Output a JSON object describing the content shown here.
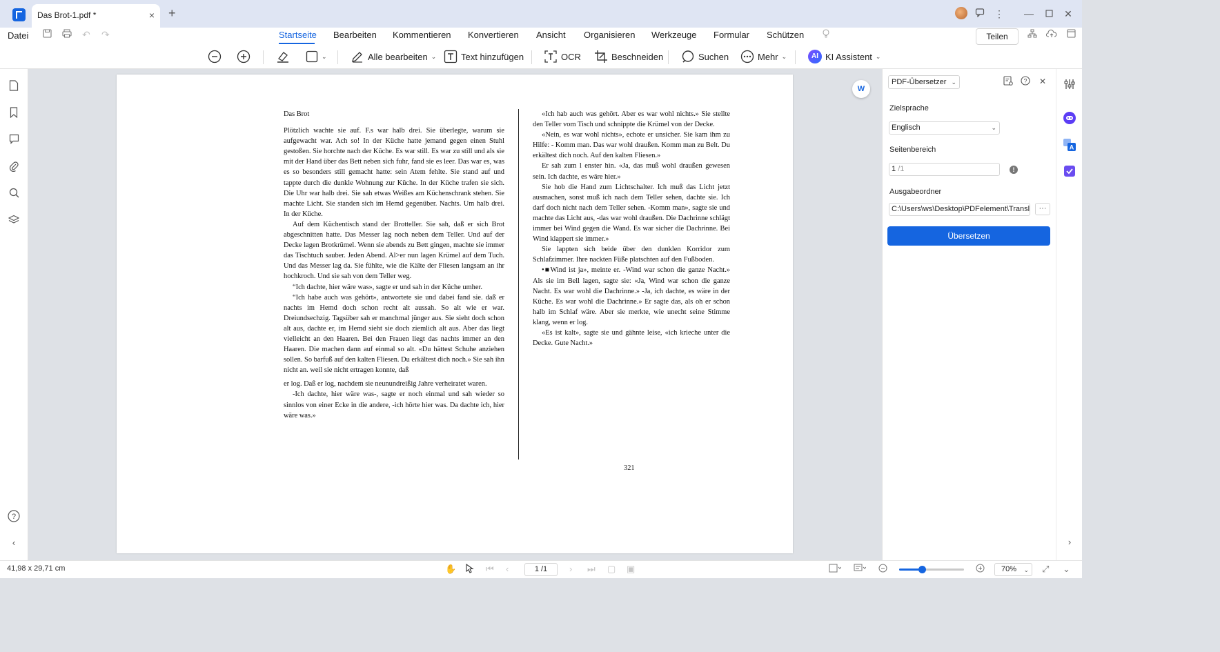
{
  "titlebar": {
    "tab_title": "Das Brot-1.pdf *",
    "tab_close": "×",
    "new_tab": "+",
    "icons": [
      "avatar",
      "message-icon",
      "more-vertical-icon",
      "minimize-icon",
      "maximize-icon",
      "close-icon"
    ]
  },
  "menubar": {
    "file_label": "Datei",
    "tabs": [
      "Startseite",
      "Bearbeiten",
      "Kommentieren",
      "Konvertieren",
      "Ansicht",
      "Organisieren",
      "Werkzeuge",
      "Formular",
      "Schützen"
    ],
    "active_tab": "Startseite",
    "share_label": "Teilen"
  },
  "toolbar": {
    "edit_all": "Alle bearbeiten",
    "add_text": "Text hinzufügen",
    "ocr": "OCR",
    "crop": "Beschneiden",
    "search": "Suchen",
    "more": "Mehr",
    "ai_badge": "AI",
    "ai_assistant": "KI Assistent"
  },
  "document": {
    "heading": "Das Brot",
    "left_column": [
      "Plötzlich wachte sie auf. F.s war halb drei. Sie überlegte, warum sie aufgewacht war. Ach so! In der Küche hatte jemand gegen einen Stuhl gestoßen. Sie horchte nach der Küche. Es war still. Es war zu still und als sie mit der Hand über das Bett neben sich fuhr, fand sie es leer. Das war es, was es so besonders still gemacht hatte: sein Atem fehlte. Sie stand auf und tappte durch die dunkle Wohnung zur Küche. In der Küche trafen sie sich. Die Uhr war halb drei. Sie sah etwas Weißes am Küchenschrank stehen. Sie machte Licht. Sie standen sich im Hemd gegenüber. Nachts. Um halb drei. In der Küche.",
      "Auf dem Küchentisch stand der Brotteller. Sie sah, daß er sich Brot abgeschnitten hatte. Das Messer lag noch neben dem Teller. Und auf der Decke lagen Brotkrümel. Wenn sie abends zu Bett gingen, machte sie immer das Tischtuch sauber. Jeden Abend. Al>er nun lagen Krümel auf dem Tuch. Und das Messer lag da. Sie fühlte, wie die Kälte der Fliesen langsam an ihr hochkroch. Und sie sah von dem Teller weg.",
      "“Ich dachte, hier wäre was», sagte er und sah in der Küche umher.",
      "“Ich habe auch was gehört», antwortete sie und dabei fand sie. daß er nachts im Hemd doch schon recht alt aussah. So alt wie er war. Dreiundsechzig. Tagsüber sah er manchmal jünger aus. Sie sieht doch schon alt aus, dachte er, im Hemd sieht sie doch ziemlich alt aus. Aber das liegt vielleicht an den Haaren. Bei den Frauen liegt das nachts immer an den Haaren. Die machen dann auf einmal so alt. «Du hättest Schuhe anziehen sollen. So barfuß auf den kalten Fliesen. Du erkältest dich noch.» Sie sah ihn nicht an. weil sie nicht ertragen konnte, daß",
      "er log. Daß er log, nachdem sie neunundreißig Jahre verheiratet waren.",
      "-Ich dachte, hier wäre was-, sagte er noch einmal und sah wieder so sinnlos von einer Ecke in die andere, -ich hörte hier was. Da dachte ich, hier wäre was.»"
    ],
    "right_column": [
      "«Ich hab auch was gehört. Aber es war wohl nichts.» Sie stellte den Teller vom Tisch und schnippte die Krümel von der Decke.",
      "«Nein, es war wohl nichts», echote er unsicher. Sie kam ihm zu Hilfe: - Komm man. Das war wohl draußen. Komm man zu Belt. Du erkältest dich noch. Auf den kalten Fliesen.»",
      "Er sah zum l enster hin. «Ja, das muß wohl draußen gewesen sein. Ich dachte, es wäre hier.»",
      "Sie hob die Hand zum Lichtschalter. Ich muß das Licht jetzt ausmachen, sonst muß ich nach dem Teller sehen, dachte sie. Ich darf doch nicht nach dem Teller sehen. -Komm man», sagte sie und machte das Licht aus, -das war wohl draußen. Die Dachrinne schlägt immer bei Wind gegen die Wand. Es war sicher die Dachrinne. Bei Wind klappert sie immer.»",
      "Sie lappten sich beide über den dunklen Korridor zum Schlafzimmer. Ihre nackten Füße platschten auf den Fußboden.",
      "•■Wind ist ja», meinte er. -Wind war schon die ganze Nacht.» Als sie im Bell lagen, sagte sie: «Ja, Wind war schon die ganze Nacht. Es war wohl die Dachrinne.» -Ja, ich dachte, es wäre in der Küche. Es war wohl die Dachrinne.» Er sagte das, als oh er schon halb im Schlaf wäre. Aber sie merkte, wie unecht seine Stimme klang, wenn er log.",
      "«Es ist kalt», sagte sie und gähnte leise, «ich krieche unter die Decke. Gute Nacht.»"
    ],
    "page_number": "321",
    "float_button": "W"
  },
  "translator_panel": {
    "tool_select": "PDF-Übersetzer",
    "target_language_label": "Zielsprache",
    "target_language": "Englisch",
    "page_range_label": "Seitenbereich",
    "page_range_value": "1",
    "page_range_total": "/1",
    "output_folder_label": "Ausgabeordner",
    "output_folder": "C:\\Users\\ws\\Desktop\\PDFelement\\Translat",
    "browse_label": "···",
    "translate_button": "Übersetzen"
  },
  "statusbar": {
    "page_size": "41,98 x 29,71 cm",
    "page_indicator": "1 /1",
    "zoom_percent": 70,
    "zoom_label": "70%"
  },
  "colors": {
    "accent": "#1565e0",
    "canvas": "#dee1e6",
    "titlebar": "#dfe5f3"
  }
}
